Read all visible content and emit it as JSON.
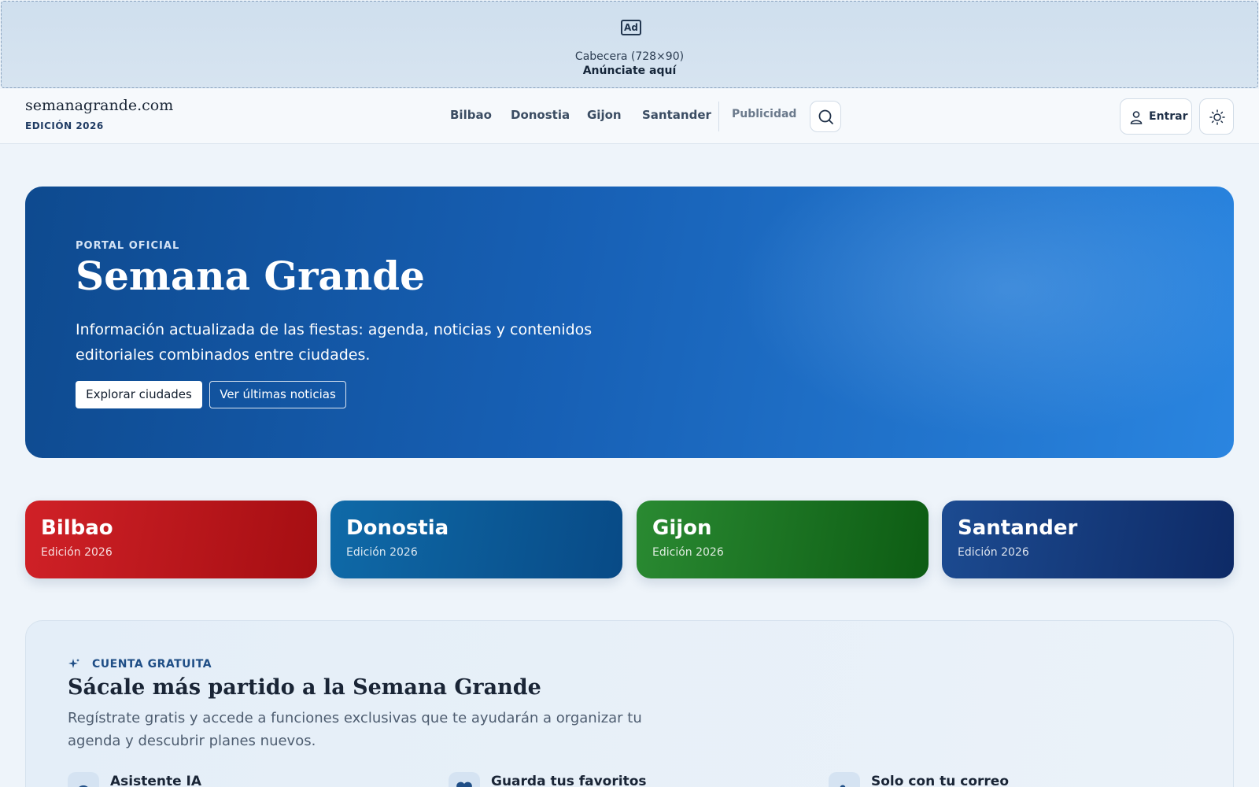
{
  "ad": {
    "icon": "ad-icon",
    "icon_text": "Ad",
    "size_label": "Cabecera (728×90)",
    "cta": "Anúnciate aquí"
  },
  "header": {
    "brand": "semanagrande.com",
    "edition": "EDICIÓN 2026",
    "nav": [
      "Bilbao",
      "Donostia",
      "Gijon",
      "Santander"
    ],
    "advertising": "Publicidad",
    "search_icon": "search-icon",
    "login_label": "Entrar",
    "user_icon": "user-icon",
    "theme_icon": "sun-icon"
  },
  "hero": {
    "kicker": "PORTAL OFICIAL",
    "title": "Semana Grande",
    "subtitle": "Información actualizada de las fiestas: agenda, noticias y contenidos editoriales combinados entre ciudades.",
    "primary_button": "Explorar ciudades",
    "secondary_button": "Ver últimas noticias"
  },
  "cities": [
    {
      "name": "Bilbao",
      "edition": "Edición 2026",
      "color": "#c1121a"
    },
    {
      "name": "Donostia",
      "edition": "Edición 2026",
      "color": "#0c5a9c"
    },
    {
      "name": "Gijon",
      "edition": "Edición 2026",
      "color": "#1a7a24"
    },
    {
      "name": "Santander",
      "edition": "Edición 2026",
      "color": "#143a80"
    }
  ],
  "account": {
    "kicker": "CUENTA GRATUITA",
    "kicker_icon": "sparkle-icon",
    "title": "Sácale más partido a la Semana Grande",
    "subtitle": "Regístrate gratis y accede a funciones exclusivas que te ayudarán a organizar tu agenda y descubrir planes nuevos.",
    "features": [
      {
        "label": "Asistente IA",
        "icon": "chat-icon"
      },
      {
        "label": "Guarda tus favoritos",
        "icon": "heart-icon"
      },
      {
        "label": "Solo con tu correo",
        "icon": "user-check-icon"
      }
    ]
  }
}
